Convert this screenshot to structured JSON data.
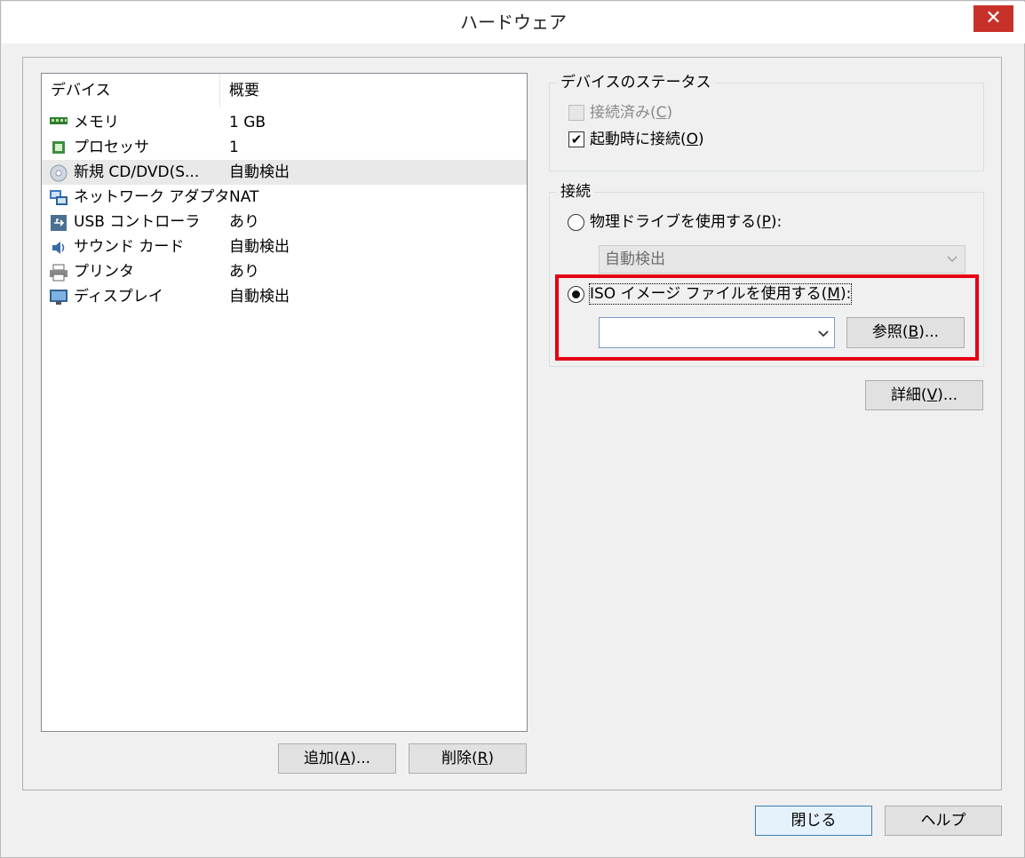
{
  "window": {
    "title": "ハードウェア",
    "close_glyph": "✕"
  },
  "device_list": {
    "col_device": "デバイス",
    "col_summary": "概要",
    "rows": [
      {
        "name": "メモリ",
        "summary": "1 GB",
        "icon": "memory-icon"
      },
      {
        "name": "プロセッサ",
        "summary": "1",
        "icon": "processor-icon"
      },
      {
        "name": "新規 CD/DVD(S...",
        "summary": "自動検出",
        "icon": "cd-dvd-icon",
        "selected": true
      },
      {
        "name": "ネットワーク アダプタ",
        "summary": "NAT",
        "icon": "network-adapter-icon"
      },
      {
        "name": "USB コントローラ",
        "summary": "あり",
        "icon": "usb-icon"
      },
      {
        "name": "サウンド カード",
        "summary": "自動検出",
        "icon": "sound-card-icon"
      },
      {
        "name": "プリンタ",
        "summary": "あり",
        "icon": "printer-icon"
      },
      {
        "name": "ディスプレイ",
        "summary": "自動検出",
        "icon": "display-icon"
      }
    ]
  },
  "list_buttons": {
    "add": {
      "text": "追加(",
      "key": "A",
      "tail": ")..."
    },
    "remove": {
      "text": "削除(",
      "key": "R",
      "tail": ")"
    }
  },
  "device_status": {
    "label": "デバイスのステータス",
    "connected": {
      "text": "接続済み(",
      "key": "C",
      "tail": ")",
      "checked": false,
      "enabled": false
    },
    "connect_at_power_on": {
      "text": "起動時に接続(",
      "key": "O",
      "tail": ")",
      "checked": true
    }
  },
  "connection": {
    "label": "接続",
    "physical": {
      "text": "物理ドライブを使用する(",
      "key": "P",
      "tail": "):",
      "selected": false
    },
    "physical_combo_value": "自動検出",
    "iso": {
      "text": "ISO イメージ ファイルを使用する(",
      "key": "M",
      "tail": "):",
      "selected": true
    },
    "iso_combo_value": "",
    "browse": {
      "text": "参照(",
      "key": "B",
      "tail": ")..."
    }
  },
  "advanced": {
    "text": "詳細(",
    "key": "V",
    "tail": ")..."
  },
  "footer": {
    "close": "閉じる",
    "help": "ヘルプ"
  },
  "colors": {
    "highlight": "#e60012",
    "title_close": "#c7312a",
    "selection": "#e9e9e9"
  }
}
